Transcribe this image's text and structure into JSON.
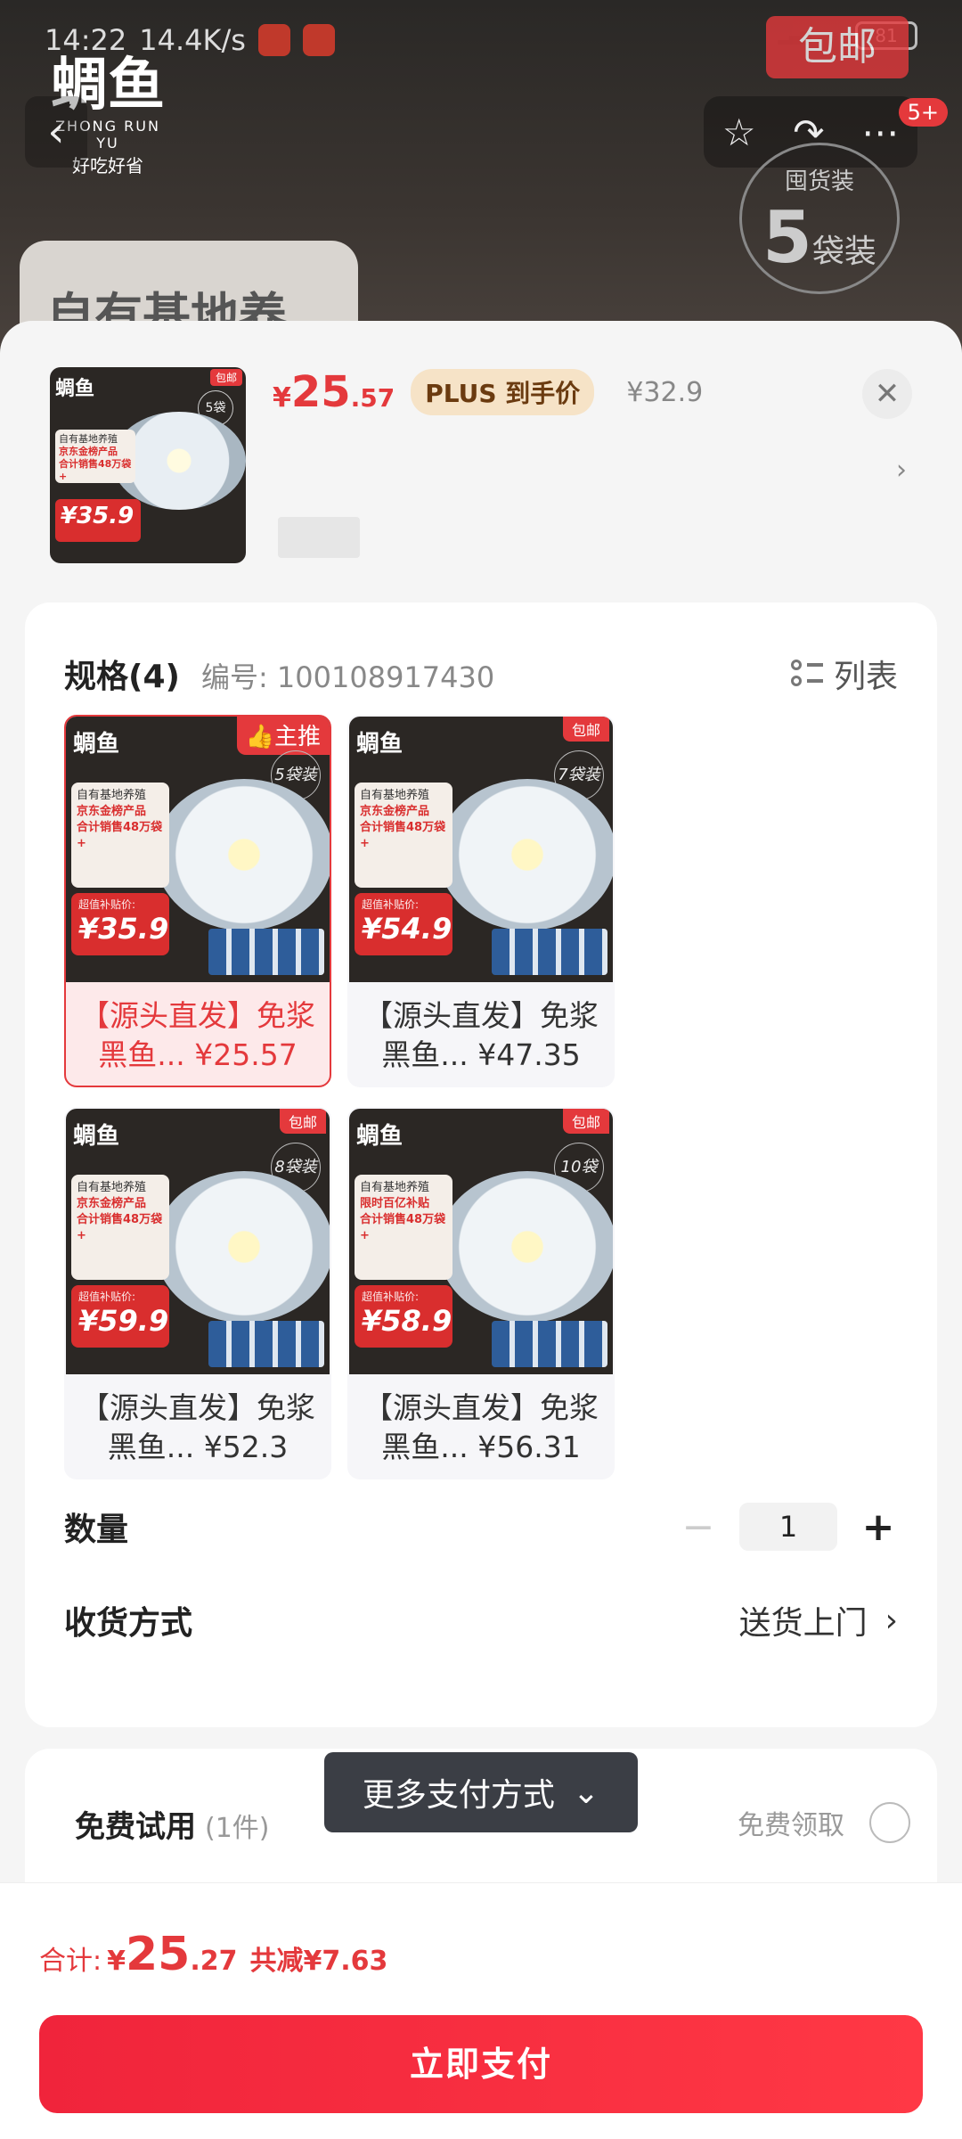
{
  "status_bar": {
    "time": "14:22",
    "speed": "14.4K/s",
    "battery": "81"
  },
  "background": {
    "logo_text": "蜩鱼",
    "logo_sub": "ZHONG RUN YU",
    "logo_tag": "好吃好省",
    "baoyou": "包邮",
    "notification_badge": "5+",
    "pack_count": "5",
    "pack_unit": "袋装",
    "pack_prefix": "囤货装",
    "banner_text": "自有基地养殖"
  },
  "header": {
    "price_yen": "¥",
    "price_int": "25",
    "price_dec": ".57",
    "plus_tag": "PLUS 到手价",
    "original_price": "¥32.9",
    "thumb": {
      "badge": "包邮",
      "logo": "蜩鱼",
      "pack_circle": "5袋",
      "label_line1": "自有基地养殖",
      "label_line2": "京东金榜产品",
      "label_line3": "合计销售48万袋+",
      "price": "¥35.9"
    }
  },
  "spec": {
    "title": "规格(4)",
    "code": "编号: 100108917430",
    "list_label": "列表",
    "items": [
      {
        "caption": "【源头直发】免浆黑鱼... ¥25.57",
        "top_tag": "主推",
        "circle": "5袋装",
        "label1": "自有基地养殖",
        "label2": "京东金榜产品",
        "label3": "合计销售48万袋+",
        "price": "¥35.9",
        "price_hint": "超值补贴价:"
      },
      {
        "caption": "【源头直发】免浆黑鱼... ¥47.35",
        "top_tag": "包邮",
        "circle": "7袋装",
        "label1": "自有基地养殖",
        "label2": "京东金榜产品",
        "label3": "合计销售48万袋+",
        "price": "¥54.9",
        "price_hint": "超值补贴价:"
      },
      {
        "caption": "【源头直发】免浆黑鱼... ¥52.3",
        "top_tag": "包邮",
        "circle": "8袋装",
        "label1": "自有基地养殖",
        "label2": "京东金榜产品",
        "label3": "合计销售48万袋+",
        "price": "¥59.9",
        "price_hint": "超值补贴价:"
      },
      {
        "caption": "【源头直发】免浆黑鱼... ¥56.31",
        "top_tag": "包邮",
        "circle": "10袋装",
        "label1": "自有基地养殖",
        "label2": "限时百亿补贴",
        "label3": "合计销售48万袋+",
        "price": "¥58.9",
        "price_hint": "超值补贴价:"
      }
    ]
  },
  "quantity": {
    "label": "数量",
    "minus": "−",
    "value": "1",
    "plus": "+"
  },
  "shipping": {
    "label": "收货方式",
    "value": "送货上门",
    "chevron": "›"
  },
  "payment": {
    "more_methods": "更多支付方式",
    "free_trial": "免费试用",
    "free_trial_count": "(1件)",
    "free_get": "免费领取"
  },
  "footer": {
    "total_label": "合计:",
    "total_yen": "¥",
    "total_int": "25",
    "total_dec": ".27",
    "total_save": "共减¥7.63",
    "pay_button": "立即支付"
  },
  "colors": {
    "accent": "#e4393c",
    "plus_tag_bg": "#f6e3c7",
    "tooltip_bg": "#3b3e45"
  }
}
